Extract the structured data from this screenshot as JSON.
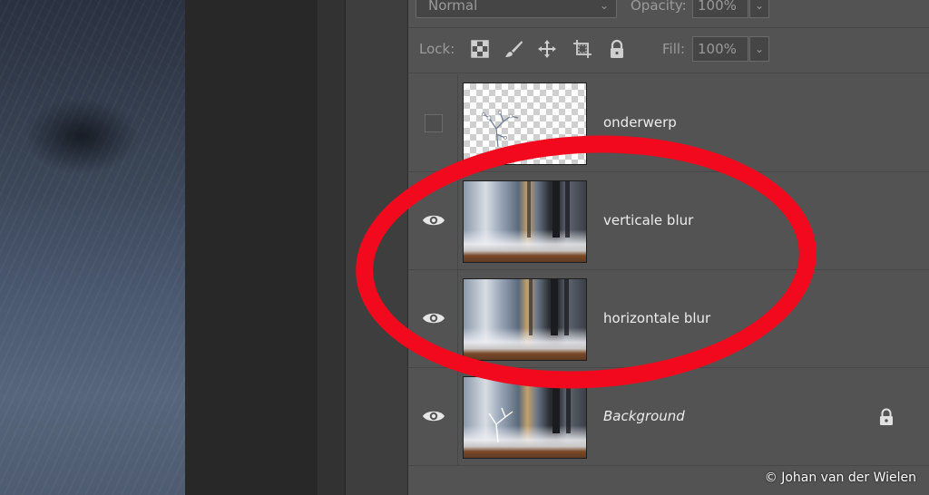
{
  "layers_panel": {
    "blend_mode": "Normal",
    "opacity_label": "Opacity:",
    "opacity_value": "100%",
    "lock_label": "Lock:",
    "fill_label": "Fill:",
    "fill_value": "100%",
    "lock_icons": [
      "lock-transparent-pixels-icon",
      "lock-image-pixels-icon",
      "lock-position-icon",
      "prevent-auto-nesting-icon",
      "lock-all-icon"
    ],
    "layers": [
      {
        "name": "onderwerp",
        "visible": false,
        "thumbnail": "transparent-subject",
        "locked": false,
        "italic": false
      },
      {
        "name": "verticale blur",
        "visible": true,
        "thumbnail": "winter-forest",
        "locked": false,
        "italic": false
      },
      {
        "name": "horizontale blur",
        "visible": true,
        "thumbnail": "winter-forest",
        "locked": false,
        "italic": false
      },
      {
        "name": "Background",
        "visible": true,
        "thumbnail": "winter-forest-subject",
        "locked": true,
        "italic": true
      }
    ]
  },
  "annotation": {
    "shape": "oval",
    "color": "#f2091d"
  },
  "copyright": "© Johan van der Wielen"
}
